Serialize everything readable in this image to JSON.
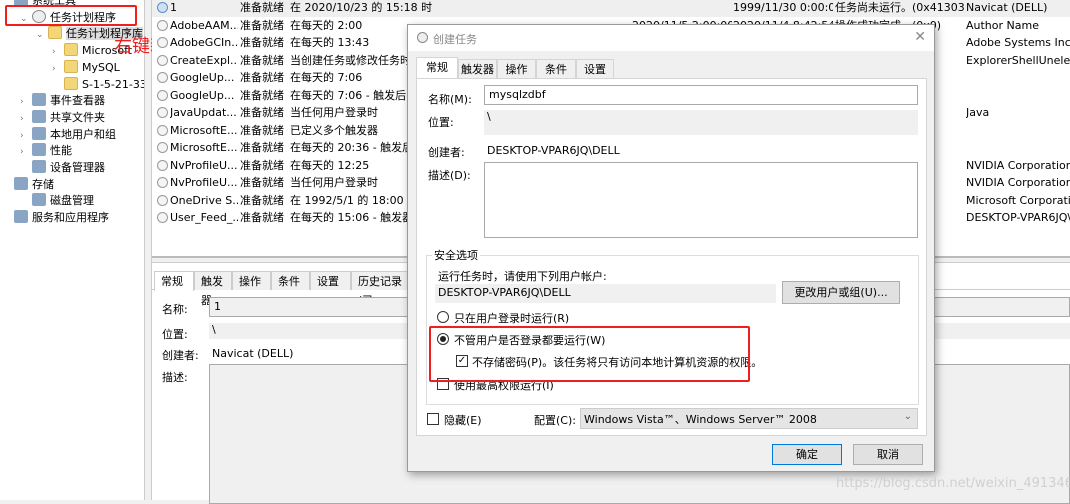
{
  "tree": [
    {
      "label": "系统工具",
      "chev": "",
      "icon": "tools-icon"
    },
    {
      "label": "任务计划程序",
      "chev": "⌄",
      "icon": "clock-icon"
    },
    {
      "label": "任务计划程序库",
      "chev": "⌄",
      "icon": "folder-clock-icon"
    },
    {
      "label": "Microsoft",
      "chev": "›",
      "icon": "folder-icon"
    },
    {
      "label": "MySQL",
      "chev": "›",
      "icon": "folder-icon"
    },
    {
      "label": "S-1-5-21-3327",
      "chev": "",
      "icon": "folder-icon"
    },
    {
      "label": "事件查看器",
      "chev": "›",
      "icon": "event-viewer-icon"
    },
    {
      "label": "共享文件夹",
      "chev": "›",
      "icon": "shared-folder-icon"
    },
    {
      "label": "本地用户和组",
      "chev": "›",
      "icon": "users-icon"
    },
    {
      "label": "性能",
      "chev": "›",
      "icon": "performance-icon"
    },
    {
      "label": "设备管理器",
      "chev": "",
      "icon": "device-manager-icon"
    },
    {
      "label": "存储",
      "chev": "",
      "icon": "storage-icon"
    },
    {
      "label": "磁盘管理",
      "chev": "",
      "icon": "disk-icon"
    },
    {
      "label": "服务和应用程序",
      "chev": "",
      "icon": "services-icon"
    }
  ],
  "annotation": "右键新建任务",
  "tasks": [
    {
      "name": "1",
      "status": "准备就绪",
      "trigger": "在 2020/10/23 的 15:18 时",
      "next": "",
      "last": "1999/11/30 0:00:00",
      "result": "任务尚未运行。(0x41303)",
      "author": "Navicat (DELL)"
    },
    {
      "name": "AdobeAAM...",
      "status": "准备就绪",
      "trigger": "在每天的 2:00",
      "next": "2020/11/5 2:00:00",
      "last": "2020/11/4 8:42:54",
      "result": "操作成功完成。(0x0)",
      "author": "Author Name"
    },
    {
      "name": "AdobeGCIn...",
      "status": "准备就绪",
      "trigger": "在每天的 13:43",
      "next": "",
      "last": "",
      "result": "",
      "author": "Adobe Systems Incor"
    },
    {
      "name": "CreateExpl...",
      "status": "准备就绪",
      "trigger": "当创建任务或修改任务时",
      "next": "",
      "last": "",
      "result": "",
      "author": "ExplorerShellUnelevat"
    },
    {
      "name": "GoogleUp...",
      "status": "准备就绪",
      "trigger": "在每天的 7:06",
      "next": "",
      "last": "",
      "result": "",
      "author": ""
    },
    {
      "name": "GoogleUp...",
      "status": "准备就绪",
      "trigger": "在每天的 7:06 - 触发后，",
      "next": "",
      "last": "",
      "result": "",
      "author": ""
    },
    {
      "name": "JavaUpdat...",
      "status": "准备就绪",
      "trigger": "当任何用户登录时",
      "next": "",
      "last": "",
      "result": "",
      "author": "Java"
    },
    {
      "name": "MicrosoftE...",
      "status": "准备就绪",
      "trigger": "已定义多个触发器",
      "next": "",
      "last": "",
      "result": "",
      "author": ""
    },
    {
      "name": "MicrosoftE...",
      "status": "准备就绪",
      "trigger": "在每天的 20:36 - 触发后，",
      "next": "",
      "last": "",
      "result": "",
      "author": ""
    },
    {
      "name": "NvProfileU...",
      "status": "准备就绪",
      "trigger": "在每天的 12:25",
      "next": "",
      "last": "",
      "result": "",
      "author": "NVIDIA Corporation"
    },
    {
      "name": "NvProfileU...",
      "status": "准备就绪",
      "trigger": "当任何用户登录时",
      "next": "",
      "last": "",
      "result": "",
      "author": "NVIDIA Corporation"
    },
    {
      "name": "OneDrive S...",
      "status": "准备就绪",
      "trigger": "在 1992/5/1 的 18:00 时",
      "next": "",
      "last": "",
      "result": "",
      "author": "Microsoft Corporatio"
    },
    {
      "name": "User_Feed_...",
      "status": "准备就绪",
      "trigger": "在每天的 15:06 - 触发器在",
      "next": "",
      "last": "",
      "result": "",
      "author": "DESKTOP-VPAR6JQ\\D"
    }
  ],
  "lower": {
    "tabs": [
      "常规",
      "触发器",
      "操作",
      "条件",
      "设置",
      "历史记录(已"
    ],
    "name_label": "名称:",
    "name_value": "1",
    "location_label": "位置:",
    "location_value": "\\",
    "author_label": "创建者:",
    "author_value": "Navicat (DELL)",
    "desc_label": "描述:"
  },
  "dialog": {
    "title": "创建任务",
    "close": "✕",
    "tabs": [
      "常规",
      "触发器",
      "操作",
      "条件",
      "设置"
    ],
    "name_label": "名称(M):",
    "name_value": "mysqlzdbf",
    "location_label": "位置:",
    "location_value": "\\",
    "author_label": "创建者:",
    "author_value": "DESKTOP-VPAR6JQ\\DELL",
    "desc_label": "描述(D):",
    "security_title": "安全选项",
    "run_as_label": "运行任务时，请使用下列用户帐户:",
    "run_as_value": "DESKTOP-VPAR6JQ\\DELL",
    "change_user_button": "更改用户或组(U)...",
    "radio_logged_on": "只在用户登录时运行(R)",
    "radio_whether": "不管用户是否登录都要运行(W)",
    "radio_selected": "whether",
    "no_store_password": "不存储密码(P)。该任务将只有访问本地计算机资源的权限。",
    "no_store_password_checked": true,
    "highest_privileges": "使用最高权限运行(I)",
    "highest_privileges_checked": false,
    "hidden_label": "隐藏(E)",
    "hidden_checked": false,
    "config_label": "配置(C):",
    "config_value": "Windows Vista™、Windows Server™ 2008",
    "ok_button": "确定",
    "cancel_button": "取消"
  },
  "watermark": "https://blog.csdn.net/weixin_49134658",
  "colors": {
    "annotation": "#f01f1f",
    "accent": "#0078d7"
  }
}
